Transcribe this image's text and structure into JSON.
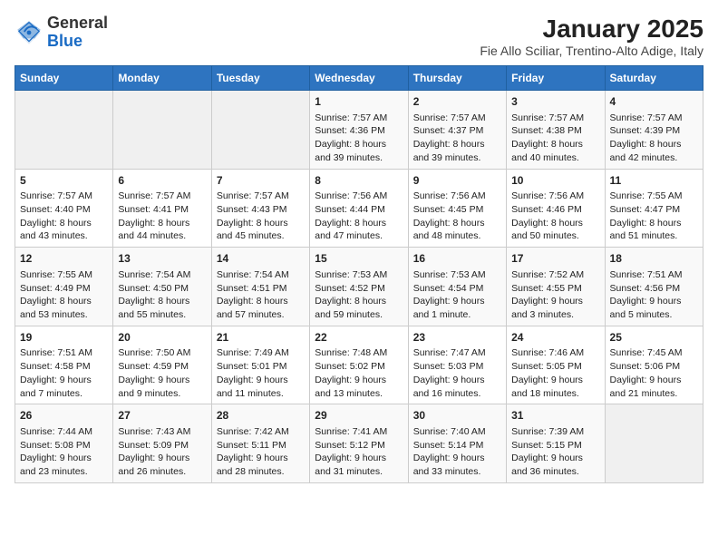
{
  "header": {
    "logo_general": "General",
    "logo_blue": "Blue",
    "title": "January 2025",
    "subtitle": "Fie Allo Sciliar, Trentino-Alto Adige, Italy"
  },
  "days_of_week": [
    "Sunday",
    "Monday",
    "Tuesday",
    "Wednesday",
    "Thursday",
    "Friday",
    "Saturday"
  ],
  "weeks": [
    [
      {
        "day": "",
        "content": ""
      },
      {
        "day": "",
        "content": ""
      },
      {
        "day": "",
        "content": ""
      },
      {
        "day": "1",
        "content": "Sunrise: 7:57 AM\nSunset: 4:36 PM\nDaylight: 8 hours\nand 39 minutes."
      },
      {
        "day": "2",
        "content": "Sunrise: 7:57 AM\nSunset: 4:37 PM\nDaylight: 8 hours\nand 39 minutes."
      },
      {
        "day": "3",
        "content": "Sunrise: 7:57 AM\nSunset: 4:38 PM\nDaylight: 8 hours\nand 40 minutes."
      },
      {
        "day": "4",
        "content": "Sunrise: 7:57 AM\nSunset: 4:39 PM\nDaylight: 8 hours\nand 42 minutes."
      }
    ],
    [
      {
        "day": "5",
        "content": "Sunrise: 7:57 AM\nSunset: 4:40 PM\nDaylight: 8 hours\nand 43 minutes."
      },
      {
        "day": "6",
        "content": "Sunrise: 7:57 AM\nSunset: 4:41 PM\nDaylight: 8 hours\nand 44 minutes."
      },
      {
        "day": "7",
        "content": "Sunrise: 7:57 AM\nSunset: 4:43 PM\nDaylight: 8 hours\nand 45 minutes."
      },
      {
        "day": "8",
        "content": "Sunrise: 7:56 AM\nSunset: 4:44 PM\nDaylight: 8 hours\nand 47 minutes."
      },
      {
        "day": "9",
        "content": "Sunrise: 7:56 AM\nSunset: 4:45 PM\nDaylight: 8 hours\nand 48 minutes."
      },
      {
        "day": "10",
        "content": "Sunrise: 7:56 AM\nSunset: 4:46 PM\nDaylight: 8 hours\nand 50 minutes."
      },
      {
        "day": "11",
        "content": "Sunrise: 7:55 AM\nSunset: 4:47 PM\nDaylight: 8 hours\nand 51 minutes."
      }
    ],
    [
      {
        "day": "12",
        "content": "Sunrise: 7:55 AM\nSunset: 4:49 PM\nDaylight: 8 hours\nand 53 minutes."
      },
      {
        "day": "13",
        "content": "Sunrise: 7:54 AM\nSunset: 4:50 PM\nDaylight: 8 hours\nand 55 minutes."
      },
      {
        "day": "14",
        "content": "Sunrise: 7:54 AM\nSunset: 4:51 PM\nDaylight: 8 hours\nand 57 minutes."
      },
      {
        "day": "15",
        "content": "Sunrise: 7:53 AM\nSunset: 4:52 PM\nDaylight: 8 hours\nand 59 minutes."
      },
      {
        "day": "16",
        "content": "Sunrise: 7:53 AM\nSunset: 4:54 PM\nDaylight: 9 hours\nand 1 minute."
      },
      {
        "day": "17",
        "content": "Sunrise: 7:52 AM\nSunset: 4:55 PM\nDaylight: 9 hours\nand 3 minutes."
      },
      {
        "day": "18",
        "content": "Sunrise: 7:51 AM\nSunset: 4:56 PM\nDaylight: 9 hours\nand 5 minutes."
      }
    ],
    [
      {
        "day": "19",
        "content": "Sunrise: 7:51 AM\nSunset: 4:58 PM\nDaylight: 9 hours\nand 7 minutes."
      },
      {
        "day": "20",
        "content": "Sunrise: 7:50 AM\nSunset: 4:59 PM\nDaylight: 9 hours\nand 9 minutes."
      },
      {
        "day": "21",
        "content": "Sunrise: 7:49 AM\nSunset: 5:01 PM\nDaylight: 9 hours\nand 11 minutes."
      },
      {
        "day": "22",
        "content": "Sunrise: 7:48 AM\nSunset: 5:02 PM\nDaylight: 9 hours\nand 13 minutes."
      },
      {
        "day": "23",
        "content": "Sunrise: 7:47 AM\nSunset: 5:03 PM\nDaylight: 9 hours\nand 16 minutes."
      },
      {
        "day": "24",
        "content": "Sunrise: 7:46 AM\nSunset: 5:05 PM\nDaylight: 9 hours\nand 18 minutes."
      },
      {
        "day": "25",
        "content": "Sunrise: 7:45 AM\nSunset: 5:06 PM\nDaylight: 9 hours\nand 21 minutes."
      }
    ],
    [
      {
        "day": "26",
        "content": "Sunrise: 7:44 AM\nSunset: 5:08 PM\nDaylight: 9 hours\nand 23 minutes."
      },
      {
        "day": "27",
        "content": "Sunrise: 7:43 AM\nSunset: 5:09 PM\nDaylight: 9 hours\nand 26 minutes."
      },
      {
        "day": "28",
        "content": "Sunrise: 7:42 AM\nSunset: 5:11 PM\nDaylight: 9 hours\nand 28 minutes."
      },
      {
        "day": "29",
        "content": "Sunrise: 7:41 AM\nSunset: 5:12 PM\nDaylight: 9 hours\nand 31 minutes."
      },
      {
        "day": "30",
        "content": "Sunrise: 7:40 AM\nSunset: 5:14 PM\nDaylight: 9 hours\nand 33 minutes."
      },
      {
        "day": "31",
        "content": "Sunrise: 7:39 AM\nSunset: 5:15 PM\nDaylight: 9 hours\nand 36 minutes."
      },
      {
        "day": "",
        "content": ""
      }
    ]
  ]
}
